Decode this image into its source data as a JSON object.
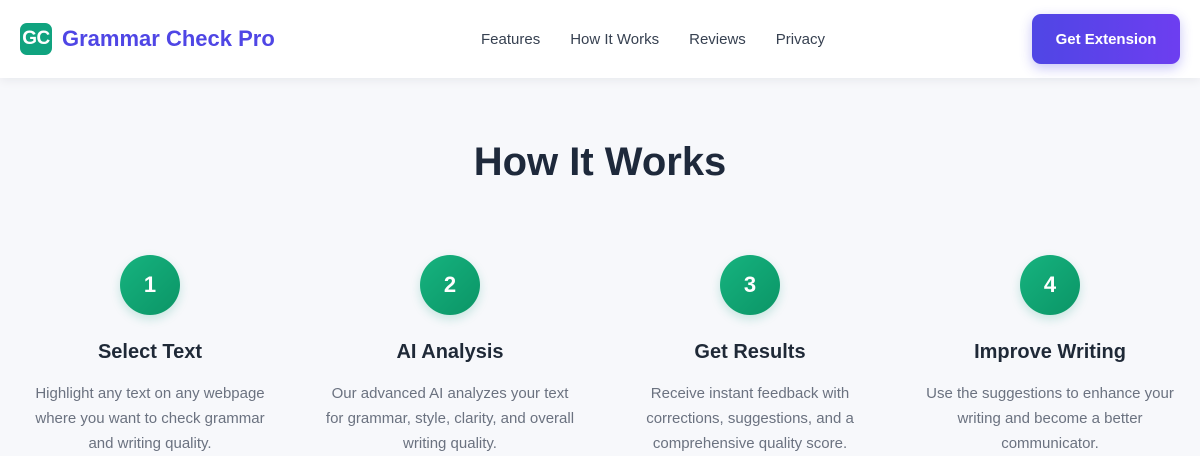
{
  "header": {
    "logo_text": "GC",
    "brand_name": "Grammar Check Pro",
    "nav": [
      "Features",
      "How It Works",
      "Reviews",
      "Privacy"
    ],
    "cta_label": "Get Extension"
  },
  "section": {
    "title": "How It Works",
    "steps": [
      {
        "number": "1",
        "title": "Select Text",
        "description": "Highlight any text on any webpage where you want to check grammar and writing quality."
      },
      {
        "number": "2",
        "title": "AI Analysis",
        "description": "Our advanced AI analyzes your text for grammar, style, clarity, and overall writing quality."
      },
      {
        "number": "3",
        "title": "Get Results",
        "description": "Receive instant feedback with corrections, suggestions, and a comprehensive quality score."
      },
      {
        "number": "4",
        "title": "Improve Writing",
        "description": "Use the suggestions to enhance your writing and become a better communicator."
      }
    ]
  },
  "colors": {
    "brand": "#4f46e5",
    "accent_green": "#10a37f",
    "cta_gradient_start": "#4f46e5",
    "cta_gradient_end": "#6d3ef0",
    "background": "#f7f8fb",
    "heading": "#1e293b",
    "body_text": "#6b7280"
  }
}
